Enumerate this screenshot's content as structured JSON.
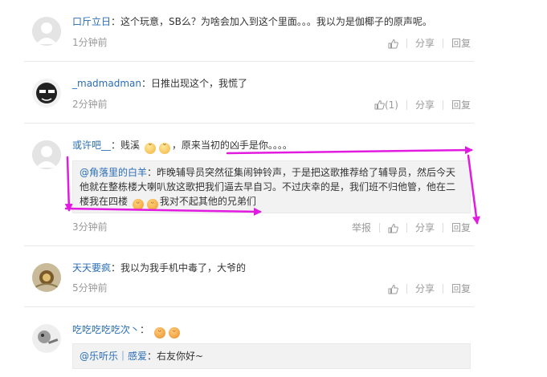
{
  "comments": [
    {
      "username": "口斤立日",
      "colon": "：",
      "text": "这个玩意，SB么？为啥会加入到这个里面。。。我以为是伽椰子的原声呢。",
      "time": "1分钟前",
      "actions": {
        "like": "",
        "share": "分享",
        "reply": "回复"
      }
    },
    {
      "username": "_madmadman",
      "colon": "：",
      "text": "日推出现这个，我慌了",
      "time": "2分钟前",
      "actions": {
        "like": "(1)",
        "share": "分享",
        "reply": "回复"
      }
    },
    {
      "username": "或许吧__",
      "colon": "：",
      "text_before": "贱溪",
      "text_after": "，原来当初的凶手是你。。。。",
      "quote_user": "@角落里的白羊",
      "quote_colon": "：",
      "quote_text": "昨晚辅导员突然征集闹钟铃声，于是把这歌推荐给了辅导员，然后今天他就在整栋楼大喇叭放这歌把我们逼去早自习。不过庆幸的是，我们班不归他管，他在二楼我在四楼",
      "quote_tail": "我对不起其他的兄弟们",
      "time": "3分钟前",
      "actions": {
        "report": "举报",
        "like": "",
        "share": "分享",
        "reply": "回复"
      }
    },
    {
      "username": "天天要疯",
      "colon": "：",
      "text": "我以为我手机中毒了，大爷的",
      "time": "5分钟前",
      "actions": {
        "like": "",
        "share": "分享",
        "reply": "回复"
      }
    },
    {
      "username": "吃吃吃吃吃次丶",
      "colon": "：",
      "text": "",
      "quote_user": "@乐听乐｜感爱",
      "quote_colon": "：",
      "quote_text": "右友你好~"
    }
  ],
  "colors": {
    "link": "#2a6db5",
    "annotation": "#e21be0",
    "meta": "#999999"
  }
}
